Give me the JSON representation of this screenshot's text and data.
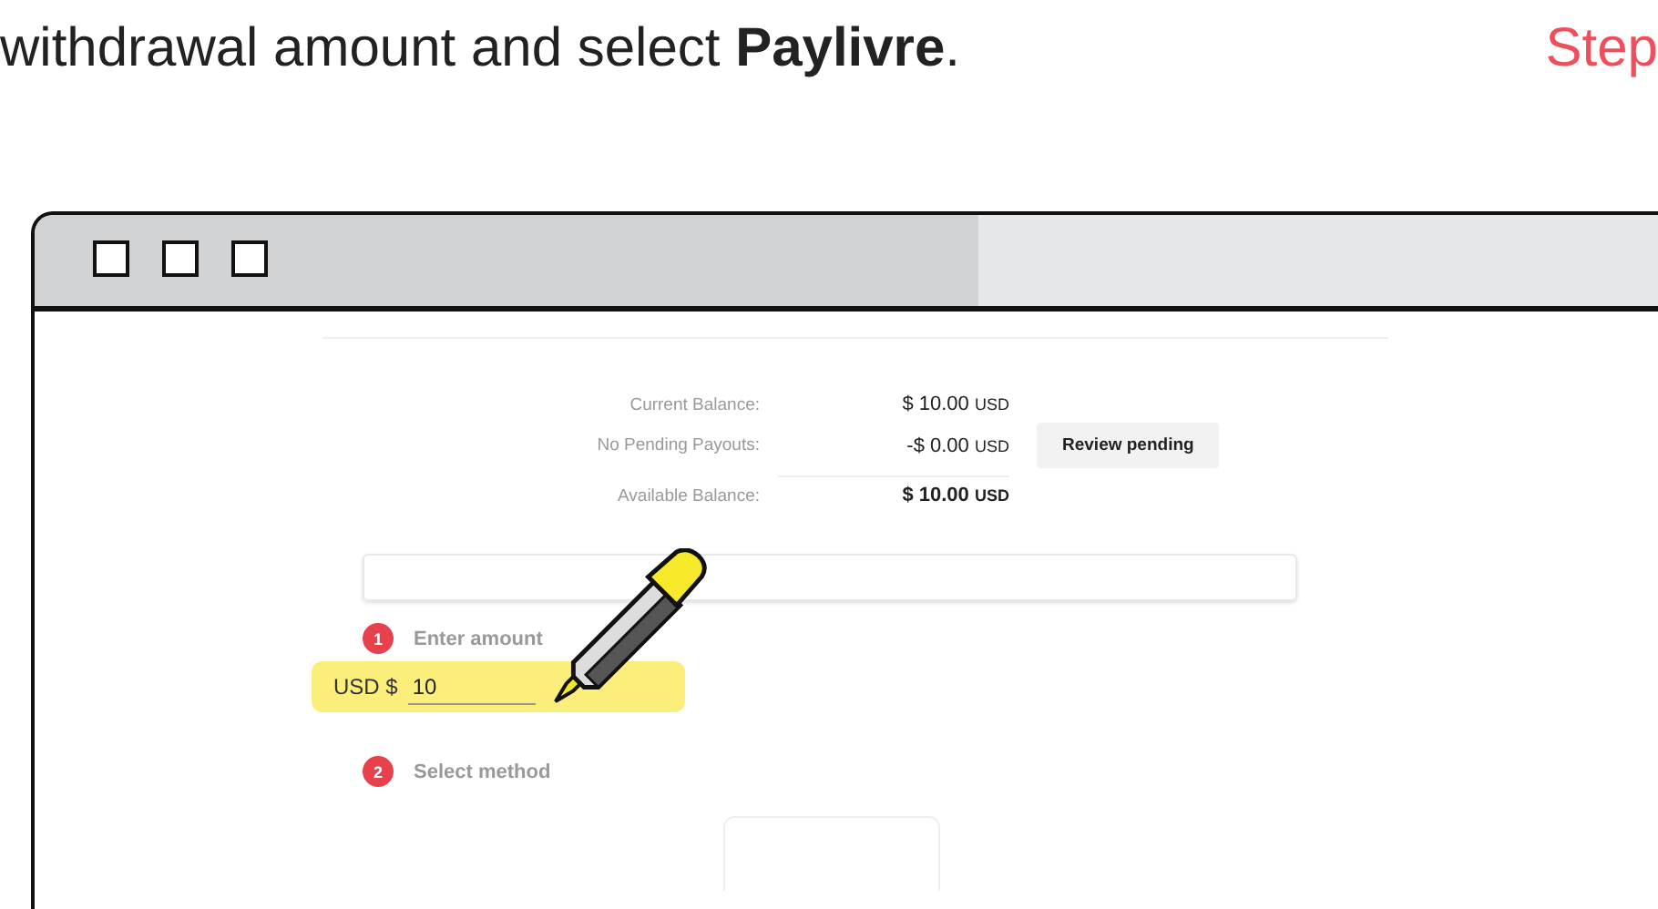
{
  "intro": {
    "text": "withdrawal amount and select **Paylivre**.",
    "step_label": "Step"
  },
  "balances": [
    {
      "label": "Current Balance:",
      "amount": "$ 10.00",
      "currency": "USD",
      "total": false
    },
    {
      "label": "No Pending Payouts:",
      "amount": "-$ 0.00",
      "currency": "USD",
      "total": false
    },
    {
      "label": "Available Balance:",
      "amount": "$ 10.00",
      "currency": "USD",
      "total": true
    }
  ],
  "review_button": "Review pending",
  "steps": [
    {
      "number": "1",
      "label": "Enter amount"
    },
    {
      "number": "2",
      "label": "Select method"
    }
  ],
  "amount_field": {
    "prefix": "USD $",
    "value": "10",
    "highlighted": true
  }
}
